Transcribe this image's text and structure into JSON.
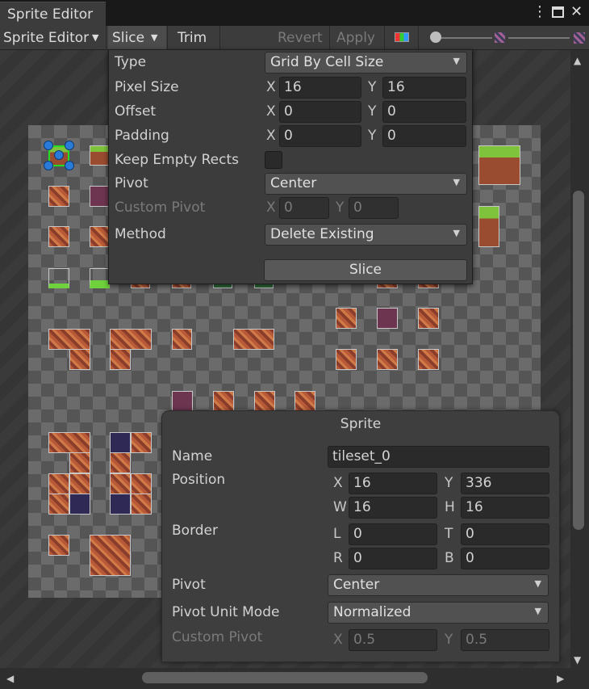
{
  "window": {
    "tab_title": "Sprite Editor"
  },
  "toolbar": {
    "mode_label": "Sprite Editor",
    "slice_label": "Slice",
    "trim_label": "Trim",
    "revert_label": "Revert",
    "apply_label": "Apply"
  },
  "slice_panel": {
    "type_label": "Type",
    "type_value": "Grid By Cell Size",
    "pixel_size_label": "Pixel Size",
    "pixel_size_x": "16",
    "pixel_size_y": "16",
    "offset_label": "Offset",
    "offset_x": "0",
    "offset_y": "0",
    "padding_label": "Padding",
    "padding_x": "0",
    "padding_y": "0",
    "keep_empty_label": "Keep Empty Rects",
    "pivot_label": "Pivot",
    "pivot_value": "Center",
    "custom_pivot_label": "Custom Pivot",
    "custom_pivot_x": "0",
    "custom_pivot_y": "0",
    "method_label": "Method",
    "method_value": "Delete Existing",
    "slice_button": "Slice",
    "x_axis": "X",
    "y_axis": "Y"
  },
  "sprite_panel": {
    "title": "Sprite",
    "name_label": "Name",
    "name_value": "tileset_0",
    "position_label": "Position",
    "pos_x": "16",
    "pos_y": "336",
    "pos_w": "16",
    "pos_h": "16",
    "border_label": "Border",
    "border_l": "0",
    "border_t": "0",
    "border_r": "0",
    "border_b": "0",
    "pivot_label": "Pivot",
    "pivot_value": "Center",
    "pivot_unit_label": "Pivot Unit Mode",
    "pivot_unit_value": "Normalized",
    "custom_pivot_label": "Custom Pivot",
    "custom_pivot_x": "0.5",
    "custom_pivot_y": "0.5",
    "axes": {
      "x": "X",
      "y": "Y",
      "w": "W",
      "h": "H",
      "l": "L",
      "t": "T",
      "r": "R",
      "b": "B"
    }
  },
  "icons": [
    "more-options-icon",
    "maximize-icon",
    "close-icon",
    "dropdown-caret-icon",
    "color-channel-icon",
    "zoom-small-icon",
    "zoom-large-icon",
    "scroll-up-icon",
    "scroll-down-icon",
    "scroll-left-icon",
    "scroll-right-icon"
  ],
  "colors": {
    "selection": "#2aa0e0",
    "selection_outline": "#22dd22",
    "grass": "#7fc23c",
    "brick": "#b85a38"
  }
}
